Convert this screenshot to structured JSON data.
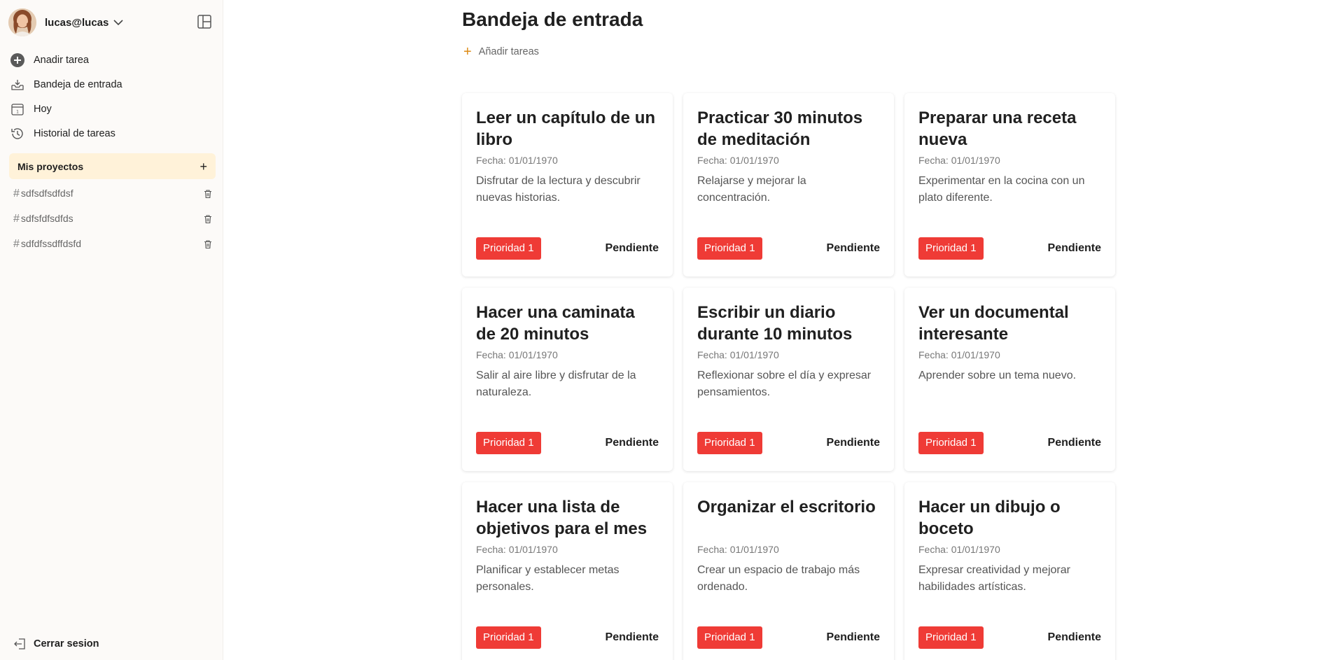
{
  "user": {
    "name": "lucas@lucas"
  },
  "nav": [
    {
      "label": "Anadir tarea",
      "icon": "add-circle-icon"
    },
    {
      "label": "Bandeja de entrada",
      "icon": "inbox-icon"
    },
    {
      "label": "Hoy",
      "icon": "calendar-icon"
    },
    {
      "label": "Historial de tareas",
      "icon": "history-icon"
    }
  ],
  "projects_section": {
    "title": "Mis proyectos"
  },
  "projects": [
    {
      "name": "sdfsdfsdfdsf"
    },
    {
      "name": "sdfsfdfsdfds"
    },
    {
      "name": "sdfdfssdffdsfd"
    }
  ],
  "logout": {
    "label": "Cerrar sesion"
  },
  "main": {
    "title": "Bandeja de entrada",
    "add_tasks_label": "Añadir tareas"
  },
  "tasks": [
    {
      "title": "Leer un capítulo de un libro",
      "date": "Fecha: 01/01/1970",
      "description": "Disfrutar de la lectura y descubrir nuevas historias.",
      "priority": "Prioridad 1",
      "status": "Pendiente"
    },
    {
      "title": "Practicar 30 minutos de meditación",
      "date": "Fecha: 01/01/1970",
      "description": "Relajarse y mejorar la concentración.",
      "priority": "Prioridad 1",
      "status": "Pendiente"
    },
    {
      "title": "Preparar una receta nueva",
      "date": "Fecha: 01/01/1970",
      "description": "Experimentar en la cocina con un plato diferente.",
      "priority": "Prioridad 1",
      "status": "Pendiente"
    },
    {
      "title": "Hacer una caminata de 20 minutos",
      "date": "Fecha: 01/01/1970",
      "description": "Salir al aire libre y disfrutar de la naturaleza.",
      "priority": "Prioridad 1",
      "status": "Pendiente"
    },
    {
      "title": "Escribir un diario durante 10 minutos",
      "date": "Fecha: 01/01/1970",
      "description": "Reflexionar sobre el día y expresar pensamientos.",
      "priority": "Prioridad 1",
      "status": "Pendiente"
    },
    {
      "title": "Ver un documental interesante",
      "date": "Fecha: 01/01/1970",
      "description": "Aprender sobre un tema nuevo.",
      "priority": "Prioridad 1",
      "status": "Pendiente"
    },
    {
      "title": "Hacer una lista de objetivos para el mes",
      "date": "Fecha: 01/01/1970",
      "description": "Planificar y establecer metas personales.",
      "priority": "Prioridad 1",
      "status": "Pendiente"
    },
    {
      "title": "Organizar el escritorio",
      "date": "Fecha: 01/01/1970",
      "description": "Crear un espacio de trabajo más ordenado.",
      "priority": "Prioridad 1",
      "status": "Pendiente"
    },
    {
      "title": "Hacer un dibujo o boceto",
      "date": "Fecha: 01/01/1970",
      "description": "Expresar creatividad y mejorar habilidades artísticas.",
      "priority": "Prioridad 1",
      "status": "Pendiente"
    }
  ],
  "colors": {
    "sidebar_bg": "#fcfaf8",
    "projects_header_bg": "#fff2d9",
    "priority_badge": "#ef3b36",
    "accent_plus": "#dc8a14"
  }
}
